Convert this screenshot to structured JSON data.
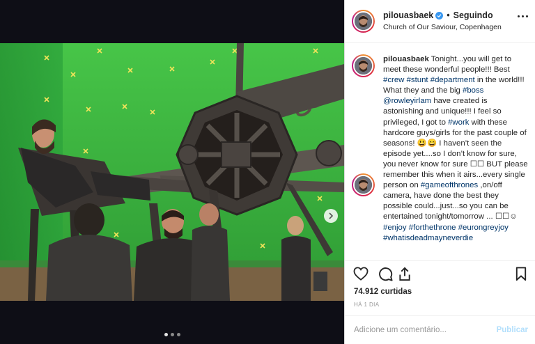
{
  "post": {
    "username": "pilouasbaek",
    "follow_separator": "•",
    "follow_label": "Seguindo",
    "location": "Church of Our Saviour, Copenhagen"
  },
  "caption": {
    "username": "pilouasbaek",
    "parts": [
      {
        "type": "text",
        "text": " Tonight...you will get to meet these wonderful people!!! Best "
      },
      {
        "type": "tag",
        "text": "#crew"
      },
      {
        "type": "text",
        "text": " "
      },
      {
        "type": "tag",
        "text": "#stunt"
      },
      {
        "type": "text",
        "text": " "
      },
      {
        "type": "tag",
        "text": "#department"
      },
      {
        "type": "text",
        "text": " in the world!!! What they and the big "
      },
      {
        "type": "tag",
        "text": "#boss"
      },
      {
        "type": "text",
        "text": " "
      },
      {
        "type": "tag",
        "text": "@rowleyirlam"
      },
      {
        "type": "text",
        "text": " have created is astonishing and unique!!! I feel so privileged, I got to "
      },
      {
        "type": "tag",
        "text": "#work"
      },
      {
        "type": "text",
        "text": " with these hardcore guys/girls for the past couple of seasons! 😃😄 I haven’t seen the episode yet....so I don’t know for sure, you never know for sure ☐☐ BUT please remember this when it airs...every single person on "
      },
      {
        "type": "tag",
        "text": "#gameofthrones"
      },
      {
        "type": "text",
        "text": " ,on/off camera, have done the best they possible could...just...so you can be entertained tonight/tomorrow ... ☐☐☺ "
      },
      {
        "type": "tag",
        "text": "#enjoy"
      },
      {
        "type": "text",
        "text": " "
      },
      {
        "type": "tag",
        "text": "#forthethrone"
      },
      {
        "type": "text",
        "text": " "
      },
      {
        "type": "tag",
        "text": "#eurongreyjoy"
      },
      {
        "type": "text",
        "text": " "
      },
      {
        "type": "tag",
        "text": "#whatisdeadmayneverdie"
      }
    ]
  },
  "stats": {
    "likes": "74.912 curtidas",
    "time": "HÁ 1 DIA"
  },
  "comment_box": {
    "placeholder": "Adicione um comentário...",
    "publish": "Publicar"
  },
  "carousel": {
    "count": 3,
    "active": 0
  },
  "icons": {
    "like": "heart-icon",
    "comment": "comment-icon",
    "share": "share-icon",
    "save": "bookmark-icon",
    "more": "more-options-icon",
    "next": "chevron-right-icon",
    "verified": "verified-badge-icon"
  },
  "colors": {
    "link": "#003569",
    "verified": "#3897f0",
    "publish_disabled": "#b2dffc"
  }
}
